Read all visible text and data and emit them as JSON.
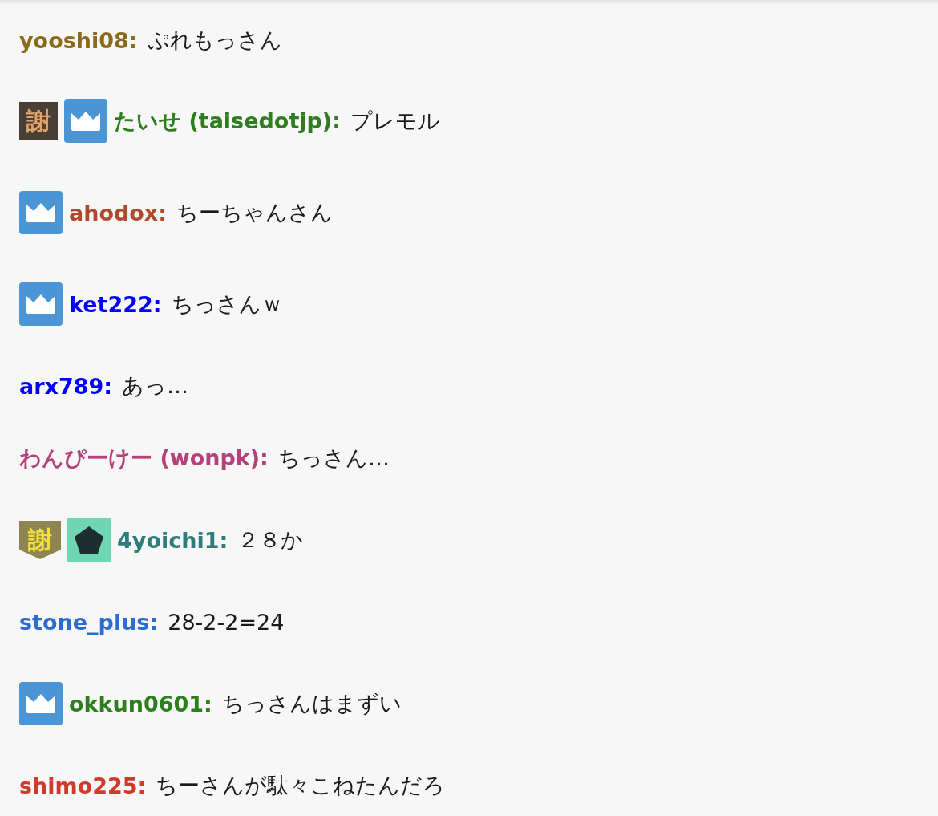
{
  "messages": [
    {
      "user": "yooshi08:",
      "color": "#8b6a1e",
      "text": "ぷれもっさん"
    },
    {
      "badges": [
        {
          "kind": "plaque",
          "text": "謝"
        },
        {
          "kind": "crown"
        }
      ],
      "user": "たいせ (taisedotjp):",
      "color": "#2e7d1f",
      "text": "プレモル"
    },
    {
      "badges": [
        {
          "kind": "crown"
        }
      ],
      "user": "ahodox:",
      "color": "#b0482a",
      "text": "ちーちゃんさん"
    },
    {
      "badges": [
        {
          "kind": "crown"
        }
      ],
      "user": "ket222:",
      "color": "#0000ff",
      "text": "ちっさんｗ"
    },
    {
      "user": "arx789:",
      "color": "#0000ff",
      "text": "あっ…"
    },
    {
      "user": "わんぴーけー (wonpk):",
      "color": "#b5407a",
      "text": "ちっさん…"
    },
    {
      "badges": [
        {
          "kind": "shield",
          "text": "謝"
        },
        {
          "kind": "gem"
        }
      ],
      "user": "4yoichi1:",
      "color": "#2e7c7c",
      "text": "２８か"
    },
    {
      "user": "stone_plus:",
      "color": "#2d6bd0",
      "text": "28-2-2=24"
    },
    {
      "badges": [
        {
          "kind": "crown"
        }
      ],
      "user": "okkun0601:",
      "color": "#2e7d1f",
      "text": "ちっさんはまずい"
    },
    {
      "user": "shimo225:",
      "color": "#d03a2a",
      "text": "ちーさんが駄々こねたんだろ"
    }
  ]
}
